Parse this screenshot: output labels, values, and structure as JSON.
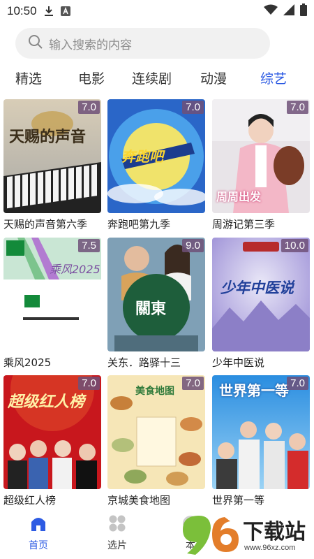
{
  "status_bar": {
    "time": "10:50",
    "download_icon": "download-icon",
    "a_icon": "a-notification-icon",
    "wifi_icon": "wifi-icon",
    "battery_icon": "battery-icon"
  },
  "search": {
    "placeholder": "输入搜索的内容",
    "icon": "search-icon"
  },
  "tabs": [
    {
      "label": "精选",
      "active": false
    },
    {
      "label": "电影",
      "active": false
    },
    {
      "label": "连续剧",
      "active": false
    },
    {
      "label": "动漫",
      "active": false
    },
    {
      "label": "综艺",
      "active": true
    }
  ],
  "cards": [
    {
      "title": "天赐的声音第六季",
      "rating": "7.0",
      "poster_text": "天赐的声音"
    },
    {
      "title": "奔跑吧第九季",
      "rating": "7.0",
      "poster_text": "奔跑吧"
    },
    {
      "title": "周游记第三季",
      "rating": "7.0",
      "poster_text": "周周出发"
    },
    {
      "title": "乘风2025",
      "rating": "7.5",
      "poster_text": "乘风2025"
    },
    {
      "title": "关东．路驿十三",
      "rating": "9.0",
      "poster_text": "關東"
    },
    {
      "title": "少年中医说",
      "rating": "10.0",
      "poster_text": "少年中医说"
    },
    {
      "title": "超级红人榜",
      "rating": "7.0",
      "poster_text": "超级红人榜"
    },
    {
      "title": "京城美食地图",
      "rating": "7.0",
      "poster_text": "美食地图"
    },
    {
      "title": "世界第一等",
      "rating": "7.0",
      "poster_text": "世界第一等"
    }
  ],
  "bottom_nav": [
    {
      "label": "首页",
      "icon": "home-icon",
      "active": true
    },
    {
      "label": "选片",
      "icon": "grid-icon",
      "active": false
    },
    {
      "label": "本",
      "icon": "circle-icon",
      "active": false
    }
  ],
  "watermark": {
    "number": "96",
    "text": "下载站",
    "url": "www.96xz.com"
  },
  "colors": {
    "accent": "#2d5be3",
    "search_bg": "#f1f1f1"
  }
}
